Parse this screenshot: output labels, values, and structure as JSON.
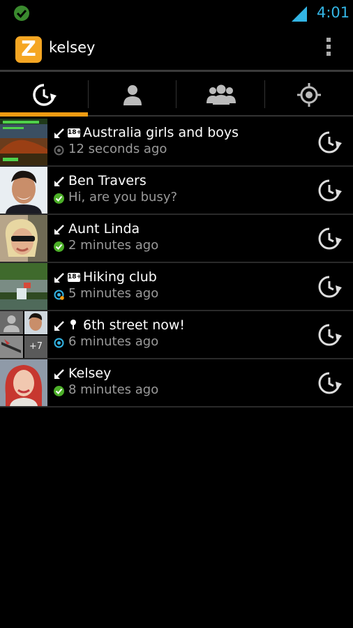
{
  "status_bar": {
    "time": "4:01"
  },
  "app": {
    "title": "kelsey",
    "logo_letter": "Z"
  },
  "tabs": [
    {
      "icon": "recent-clock-icon",
      "active": true
    },
    {
      "icon": "person-icon",
      "active": false
    },
    {
      "icon": "group-icon",
      "active": false
    },
    {
      "icon": "location-target-icon",
      "active": false
    }
  ],
  "conversations": [
    {
      "title": "Australia girls and boys",
      "subtitle": "12 seconds ago",
      "badge": "18+",
      "status": "offline",
      "thumb": "landscape-thumbnail"
    },
    {
      "title": "Ben Travers",
      "subtitle": "Hi, are you busy?",
      "status": "online",
      "thumb": "profile-photo"
    },
    {
      "title": "Aunt Linda",
      "subtitle": "2 minutes ago",
      "status": "online",
      "thumb": "profile-photo"
    },
    {
      "title": "Hiking club",
      "subtitle": "5 minutes ago",
      "badge": "18+",
      "status": "broadcast",
      "thumb": "waterfall-thumbnail"
    },
    {
      "title": "6th street now!",
      "subtitle": "6 minutes ago",
      "status": "broadcast",
      "thumb": "group-collage",
      "more_count": "+7"
    },
    {
      "title": "Kelsey",
      "subtitle": "8 minutes ago",
      "status": "online",
      "thumb": "profile-photo"
    }
  ],
  "colors": {
    "accent_orange": "#f39c12",
    "clock_blue": "#33b5e5",
    "online_green": "#4caf28",
    "broadcast_blue": "#33b5e5"
  }
}
